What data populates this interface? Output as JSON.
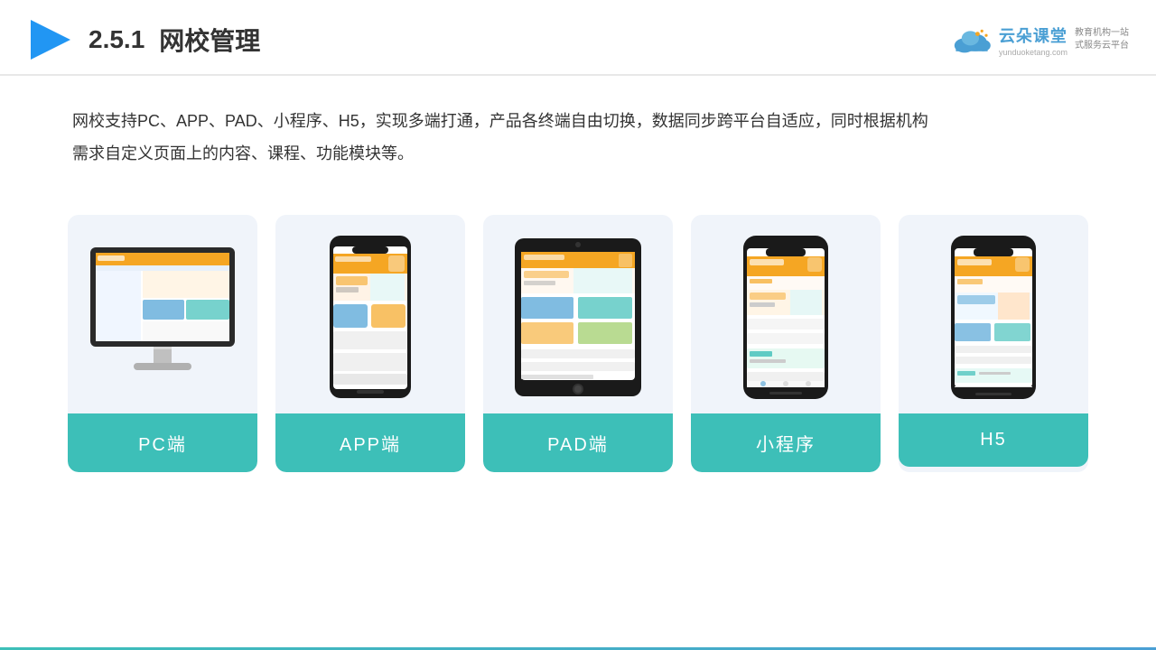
{
  "header": {
    "section_number": "2.5.1",
    "title": "网校管理",
    "brand_name": "云朵课堂",
    "brand_url": "yunduoketang.com",
    "brand_sub1": "教育机构一站",
    "brand_sub2": "式服务云平台"
  },
  "description": {
    "text": "网校支持PC、APP、PAD、小程序、H5，实现多端打通，产品各终端自由切换，数据同步跨平台自适应，同时根据机构需求自定义页面上的内容、课程、功能模块等。"
  },
  "cards": [
    {
      "id": "pc",
      "label": "PC端"
    },
    {
      "id": "app",
      "label": "APP端"
    },
    {
      "id": "pad",
      "label": "PAD端"
    },
    {
      "id": "miniprogram",
      "label": "小程序"
    },
    {
      "id": "h5",
      "label": "H5"
    }
  ],
  "colors": {
    "accent": "#3dbfb8",
    "accent2": "#4a9fd4",
    "card_bg": "#f0f4fa"
  }
}
